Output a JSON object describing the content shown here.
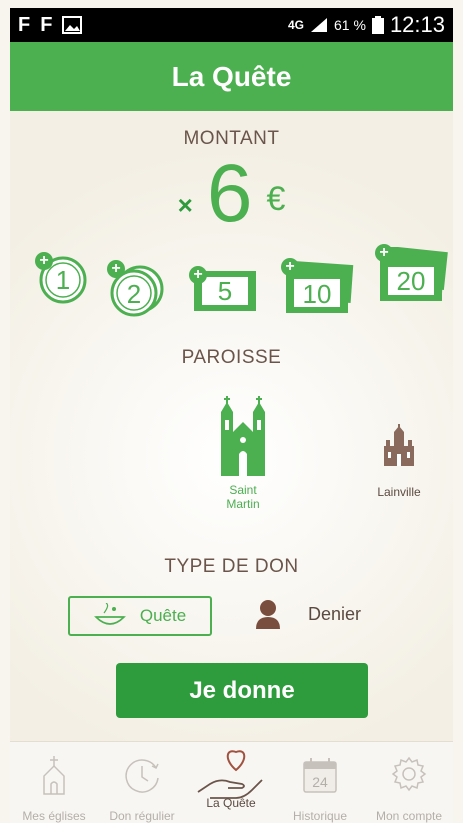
{
  "status_bar": {
    "network": "4G",
    "battery": "61 %",
    "time": "12:13"
  },
  "app_bar": {
    "title": "La Quête"
  },
  "montant": {
    "label": "MONTANT",
    "times": "×",
    "value": "6",
    "currency": "€"
  },
  "coins": [
    {
      "label": "1"
    },
    {
      "label": "2"
    },
    {
      "label": "5"
    },
    {
      "label": "10"
    },
    {
      "label": "20"
    }
  ],
  "paroisse": {
    "label": "PAROISSE",
    "items": [
      {
        "line1": "Saint",
        "line2": "Martin"
      },
      {
        "name": "Lainville"
      }
    ]
  },
  "type_don": {
    "label": "TYPE DE DON",
    "options": [
      {
        "label": "Quête"
      },
      {
        "label": "Denier"
      }
    ]
  },
  "action": {
    "label": "Je donne"
  },
  "tabs": [
    {
      "label": "Mes églises",
      "icon": "church-icon"
    },
    {
      "label": "Don régulier",
      "icon": "clock-icon"
    },
    {
      "label": "La Quête",
      "icon": "heart-hand-icon"
    },
    {
      "label": "Historique",
      "icon": "calendar-icon"
    },
    {
      "label": "Mon compte",
      "icon": "gear-icon"
    }
  ],
  "calendar_day": "24",
  "colors": {
    "primary": "#4caf50",
    "dark_green": "#2e9c3d",
    "brown": "#6b554b"
  }
}
